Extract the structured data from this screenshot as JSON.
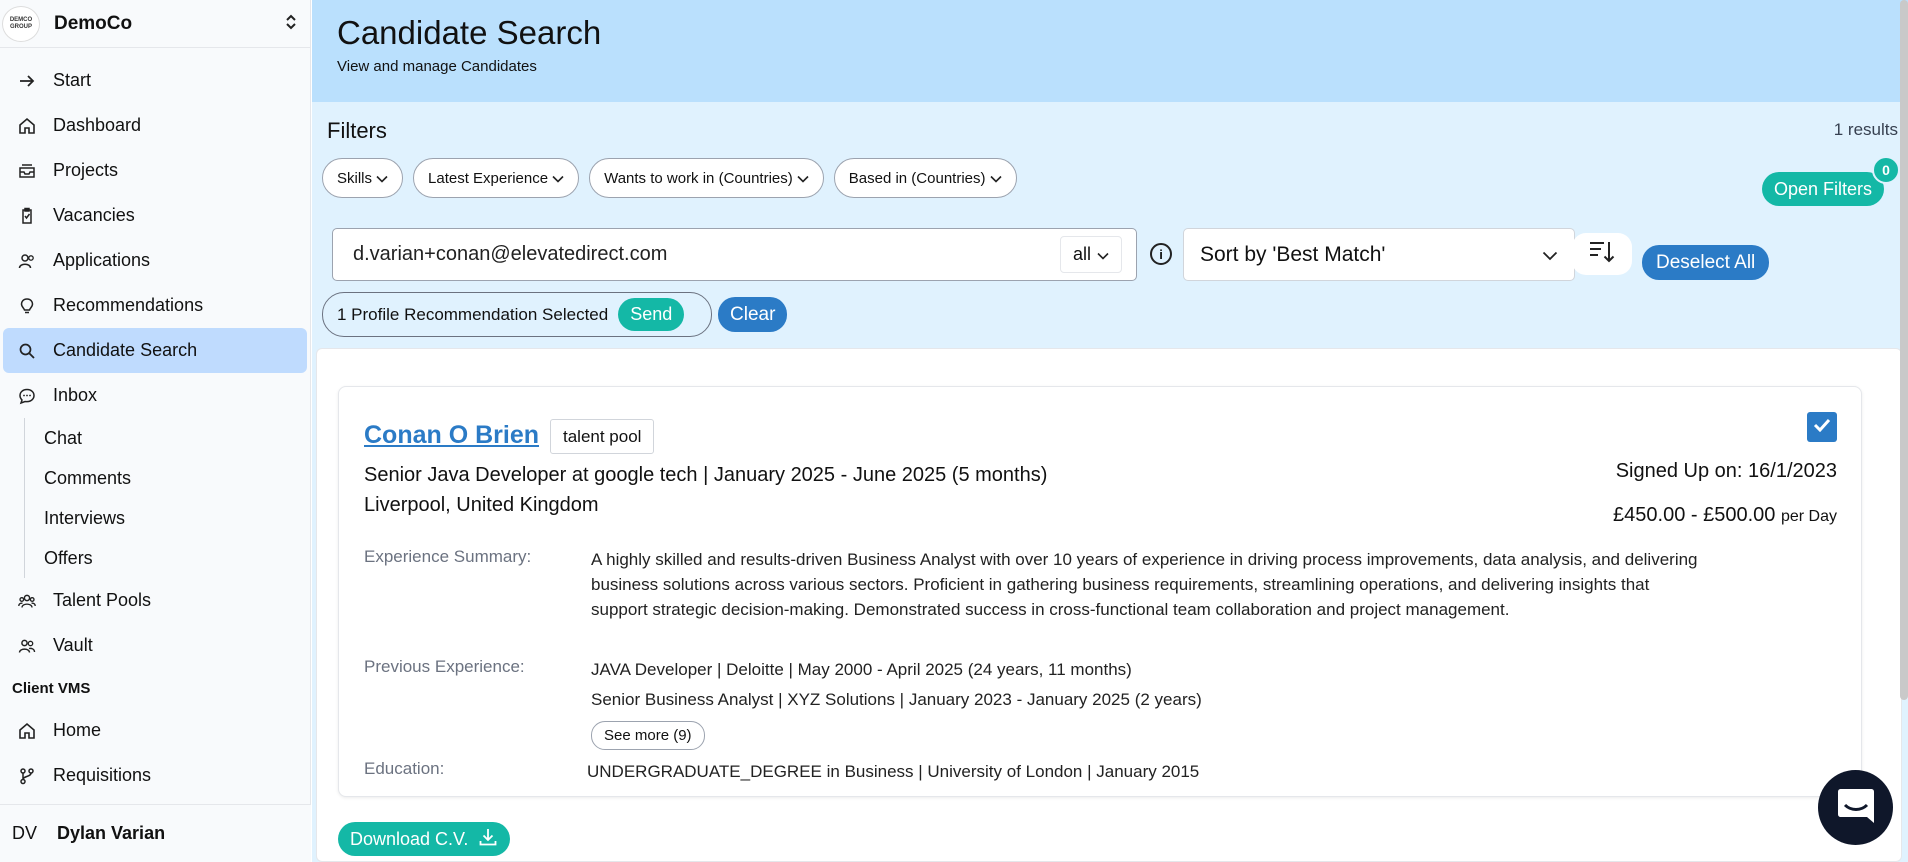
{
  "org": {
    "logo_text": "DEMCO GROUP",
    "name": "DemoCo"
  },
  "nav": {
    "items": [
      {
        "label": "Start"
      },
      {
        "label": "Dashboard"
      },
      {
        "label": "Projects"
      },
      {
        "label": "Vacancies"
      },
      {
        "label": "Applications"
      },
      {
        "label": "Recommendations"
      },
      {
        "label": "Candidate Search"
      },
      {
        "label": "Inbox"
      }
    ],
    "inbox_sub": [
      "Chat",
      "Comments",
      "Interviews",
      "Offers"
    ],
    "items2": [
      {
        "label": "Talent Pools"
      },
      {
        "label": "Vault"
      }
    ],
    "section_title": "Client VMS",
    "items3": [
      {
        "label": "Home"
      },
      {
        "label": "Requisitions"
      }
    ]
  },
  "user": {
    "initials": "DV",
    "name": "Dylan Varian"
  },
  "header": {
    "title": "Candidate Search",
    "subtitle": "View and manage Candidates"
  },
  "filters": {
    "title": "Filters",
    "results": "1 results",
    "chips": [
      "Skills",
      "Latest Experience",
      "Wants to work in (Countries)",
      "Based in (Countries)"
    ],
    "open_filters_label": "Open Filters",
    "badge_count": "0"
  },
  "search": {
    "value": "d.varian+conan@elevatedirect.com",
    "scope": "all",
    "sort": "Sort by 'Best Match'",
    "deselect_label": "Deselect All"
  },
  "selection": {
    "text": "1 Profile Recommendation Selected",
    "send_label": "Send",
    "clear_label": "Clear"
  },
  "candidate": {
    "name": "Conan O Brien",
    "tag": "talent pool",
    "role": "Senior Java Developer at google tech | January 2025 - June 2025 (5 months)",
    "location": "Liverpool, United Kingdom",
    "signed_up": "Signed Up on: 16/1/2023",
    "rate": "£450.00 - £500.00",
    "rate_unit": "per Day",
    "summary_label": "Experience Summary:",
    "summary": "A highly skilled and results-driven Business Analyst with over 10 years of experience in driving process improvements, data analysis, and delivering business solutions across various sectors. Proficient in gathering business requirements, streamlining operations, and delivering insights that support strategic decision-making. Demonstrated success in cross-functional team collaboration and project management.",
    "prev_label": "Previous Experience:",
    "prev": [
      "JAVA Developer | Deloitte | May 2000 - April 2025 (24 years, 11 months)",
      "Senior Business Analyst | XYZ Solutions | January 2023 - January 2025 (2 years)"
    ],
    "see_more": "See more (9)",
    "edu_label": "Education:",
    "edu": "UNDERGRADUATE_DEGREE in Business | University of London | January 2015",
    "download_label": "Download C.V."
  },
  "colors": {
    "accent": "#2b7bc6",
    "teal": "#14b8a6",
    "header_bg": "#bae0fd"
  }
}
